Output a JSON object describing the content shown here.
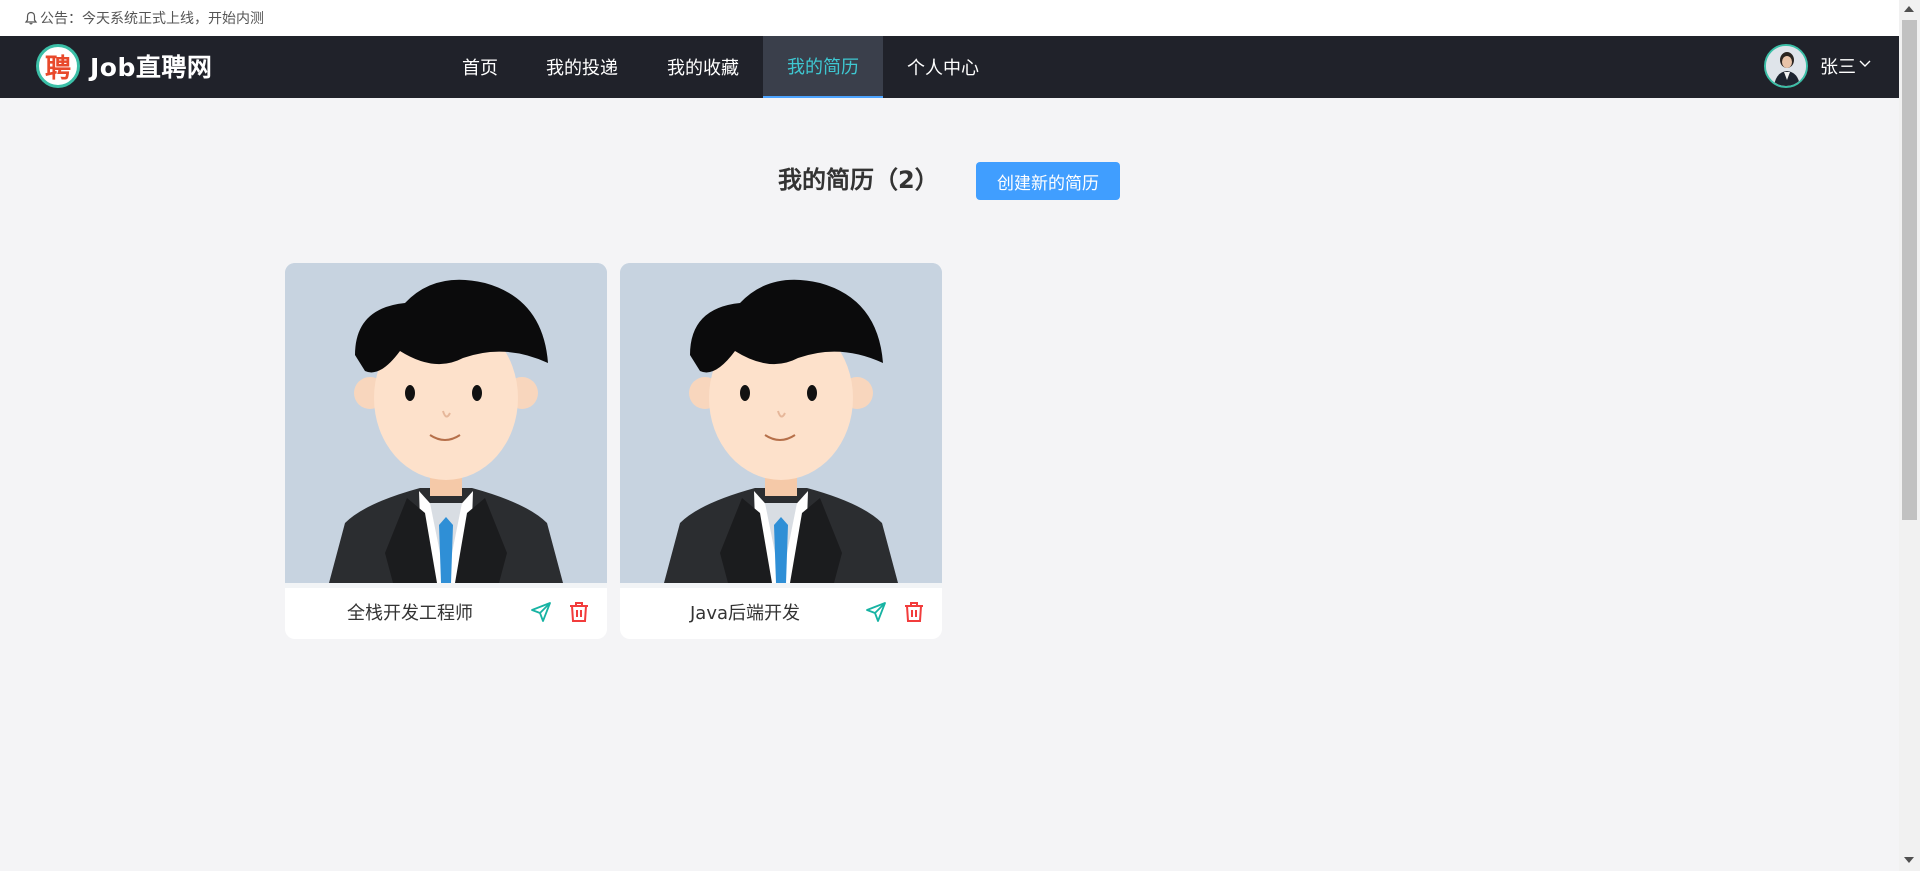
{
  "notice": {
    "icon": "bell-icon",
    "text": "公告：今天系统正式上线，开始内测"
  },
  "brand": {
    "logo_char": "聘",
    "name": "Job直聘网"
  },
  "nav": {
    "items": [
      {
        "label": "首页",
        "active": false
      },
      {
        "label": "我的投递",
        "active": false
      },
      {
        "label": "我的收藏",
        "active": false
      },
      {
        "label": "我的简历",
        "active": true
      },
      {
        "label": "个人中心",
        "active": false
      }
    ]
  },
  "user": {
    "name": "张三",
    "dropdown_icon": "chevron-down-icon"
  },
  "main": {
    "title": "我的简历（2）",
    "create_button": "创建新的简历",
    "resumes": [
      {
        "title": "全栈开发工程师",
        "send_icon": "send-icon",
        "delete_icon": "trash-icon"
      },
      {
        "title": "Java后端开发",
        "send_icon": "send-icon",
        "delete_icon": "trash-icon"
      }
    ]
  },
  "colors": {
    "nav_bg": "#20222a",
    "active_text": "#3ec8d2",
    "primary": "#409eff",
    "send": "#17b3a3",
    "delete": "#f23c3c",
    "page_bg": "#f4f4f6"
  }
}
